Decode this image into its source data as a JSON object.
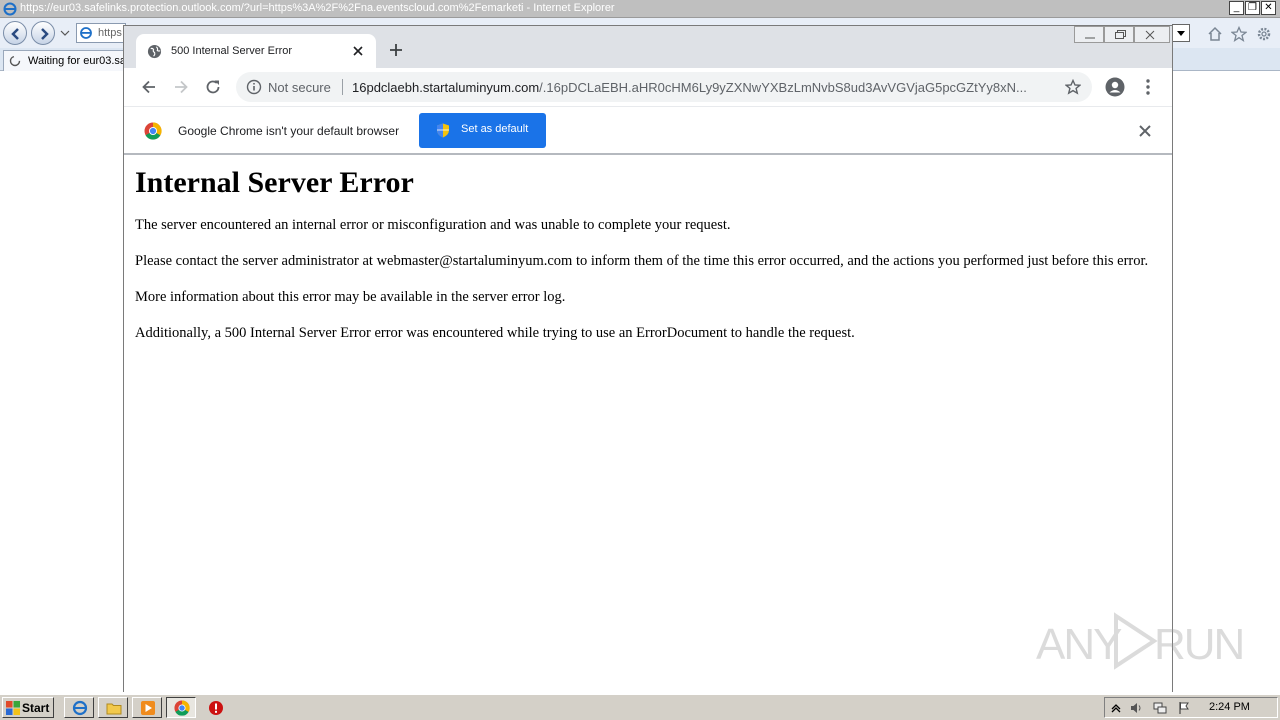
{
  "ie": {
    "title": "https://eur03.safelinks.protection.outlook.com/?url=https%3A%2F%2Fna.eventscloud.com%2Femarketi - Internet Explorer",
    "address_text": "https",
    "tab_label": "Waiting for eur03.sa",
    "window_buttons": {
      "minimize": "_",
      "restore": "❐",
      "close": "✕"
    }
  },
  "chrome": {
    "tab_title": "500 Internal Server Error",
    "omnibox": {
      "not_secure": "Not secure",
      "url_host": "16pdclaebh.startaluminyum.com",
      "url_path": "/.16pDCLaEBH.aHR0cHM6Ly9yZXNwYXBzLmNvbS8ud3AvVGVjaG5pcGZtYy8xN..."
    },
    "infobar": {
      "message": "Google Chrome isn't your default browser",
      "button_label": "Set as default"
    }
  },
  "page": {
    "heading": "Internal Server Error",
    "paragraphs": [
      "The server encountered an internal error or misconfiguration and was unable to complete your request.",
      "Please contact the server administrator at webmaster@startaluminyum.com to inform them of the time this error occurred, and the actions you performed just before this error.",
      "More information about this error may be available in the server error log.",
      "Additionally, a 500 Internal Server Error error was encountered while trying to use an ErrorDocument to handle the request."
    ]
  },
  "taskbar": {
    "start_label": "Start",
    "clock": "2:24 PM",
    "apps": [
      "ie-icon",
      "explorer-folder-icon",
      "media-player-icon",
      "chrome-icon",
      "stop-icon"
    ]
  },
  "watermark": {
    "left": "ANY",
    "right": "RUN"
  },
  "colors": {
    "chrome_blue": "#1a73e8",
    "tabstrip": "#dee1e6",
    "taskbar": "#d4d0c8"
  }
}
